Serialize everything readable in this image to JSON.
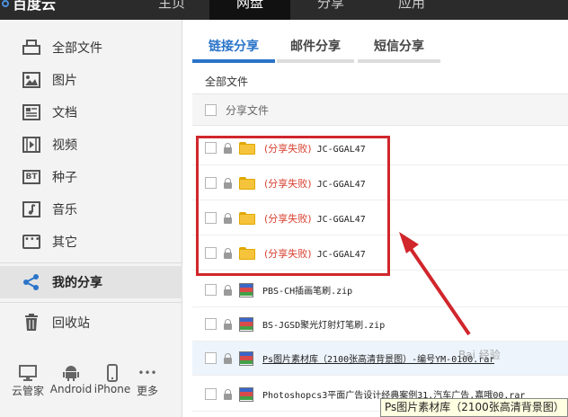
{
  "topnav": {
    "logo": "百度云",
    "items": [
      "主页",
      "网盘",
      "分享",
      "应用"
    ],
    "active_index": 1
  },
  "sidebar": {
    "items": [
      {
        "label": "全部文件",
        "icon": "printer-icon"
      },
      {
        "label": "图片",
        "icon": "image-icon"
      },
      {
        "label": "文档",
        "icon": "document-icon"
      },
      {
        "label": "视频",
        "icon": "video-icon"
      },
      {
        "label": "种子",
        "icon": "bt-icon",
        "icon_text": "BT"
      },
      {
        "label": "音乐",
        "icon": "music-icon"
      },
      {
        "label": "其它",
        "icon": "more-icon",
        "icon_text": "•••"
      },
      {
        "label": "我的分享",
        "icon": "share-icon",
        "active": true
      },
      {
        "label": "回收站",
        "icon": "trash-icon"
      }
    ],
    "devices": [
      {
        "label": "云管家",
        "icon": "monitor-icon"
      },
      {
        "label": "Android",
        "icon": "android-icon"
      },
      {
        "label": "iPhone",
        "icon": "phone-icon"
      },
      {
        "label": "更多",
        "icon": "ellipsis-icon",
        "icon_text": "•••"
      }
    ]
  },
  "tabs": [
    {
      "label": "链接分享",
      "active": true
    },
    {
      "label": "邮件分享"
    },
    {
      "label": "短信分享"
    }
  ],
  "breadcrumb": "全部文件",
  "table": {
    "header": "分享文件",
    "rows": [
      {
        "status": "(分享失败)",
        "name": "JC-GGAL47",
        "type": "folder",
        "locked": true
      },
      {
        "status": "(分享失败)",
        "name": "JC-GGAL47",
        "type": "folder",
        "locked": true
      },
      {
        "status": "(分享失败)",
        "name": "JC-GGAL47",
        "type": "folder",
        "locked": true
      },
      {
        "status": "(分享失败)",
        "name": "JC-GGAL47",
        "type": "folder",
        "locked": true
      },
      {
        "status": "",
        "name": "PBS-CH插画笔刷.zip",
        "type": "archive",
        "locked": true
      },
      {
        "status": "",
        "name": "BS-JGSD聚光灯射灯笔刷.zip",
        "type": "archive",
        "locked": true
      },
      {
        "status": "",
        "name": "Ps图片素材库（2100张高清背景图）-编号YM-0100.rar",
        "type": "archive",
        "locked": true,
        "hover": true
      },
      {
        "status": "",
        "name": "Photoshopcs3平面广告设计经典案例31.汽车广告.嘉哦00.rar",
        "type": "archive",
        "locked": true
      }
    ]
  },
  "watermark": "Bai 经验",
  "tooltip": "Ps图片素材库（2100张高清背景图）",
  "colors": {
    "accent": "#2a74c9",
    "annotation_red": "#d0262c",
    "fail_text": "#d84030",
    "topbar": "#2b2b2b"
  }
}
